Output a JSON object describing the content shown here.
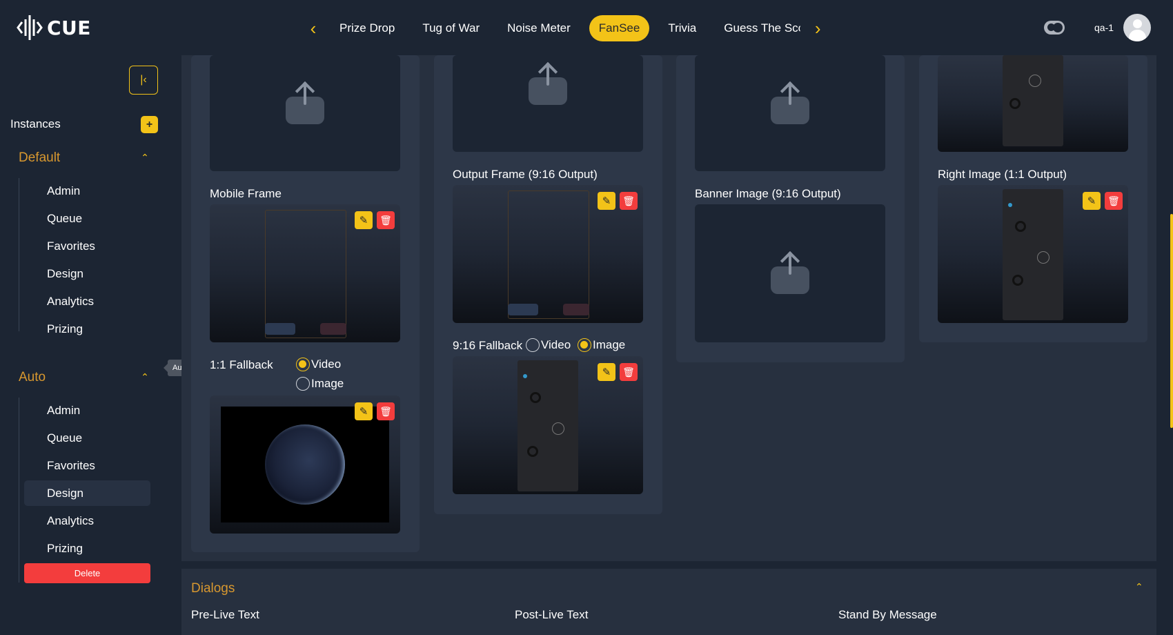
{
  "app": {
    "name": "CUE"
  },
  "nav": {
    "tabs": [
      {
        "label": "Prize Drop",
        "active": false
      },
      {
        "label": "Tug of War",
        "active": false
      },
      {
        "label": "Noise Meter",
        "active": false
      },
      {
        "label": "FanSee",
        "active": true
      },
      {
        "label": "Trivia",
        "active": false
      },
      {
        "label": "Guess The Sco",
        "active": false
      }
    ]
  },
  "user": {
    "name": "qa-1"
  },
  "sidebar": {
    "instances_label": "Instances",
    "add_label": "+",
    "groups": [
      {
        "title": "Default",
        "items": [
          "Admin",
          "Queue",
          "Favorites",
          "Design",
          "Analytics",
          "Prizing"
        ]
      },
      {
        "title": "Auto",
        "items": [
          "Admin",
          "Queue",
          "Favorites",
          "Design",
          "Analytics",
          "Prizing"
        ],
        "selected": "Design",
        "delete_label": "Delete"
      }
    ],
    "tooltip": "Auto"
  },
  "design": {
    "mobile_frame_label": "Mobile Frame",
    "fallback_1_1": {
      "label": "1:1 Fallback",
      "options": [
        "Video",
        "Image"
      ],
      "selected": "Video"
    },
    "output_frame_label": "Output Frame (9:16 Output)",
    "fallback_9_16": {
      "label": "9:16 Fallback",
      "options": [
        "Video",
        "Image"
      ],
      "selected": "Image"
    },
    "banner_image_label": "Banner Image (9:16 Output)",
    "right_image_label": "Right Image (1:1 Output)"
  },
  "dialogs": {
    "title": "Dialogs",
    "fields": [
      "Pre-Live Text",
      "Post-Live Text",
      "Stand By Message"
    ]
  },
  "colors": {
    "accent": "#f3c318",
    "danger": "#f33d3d",
    "group_title": "#d8982f",
    "background": "#1c2533"
  }
}
